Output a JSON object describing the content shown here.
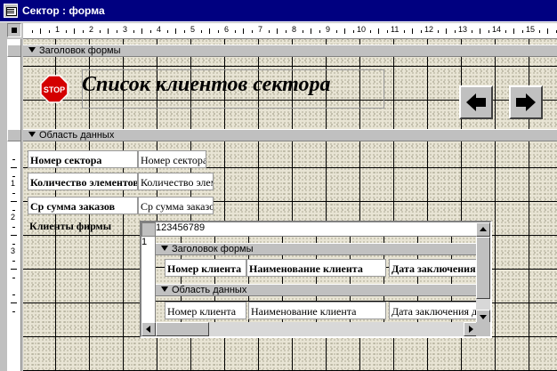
{
  "window": {
    "title": "Сектор : форма",
    "icon": "form-icon"
  },
  "ruler": {
    "numbers": [
      "1",
      "2",
      "3",
      "4",
      "5",
      "6",
      "7",
      "8",
      "9",
      "10",
      "11",
      "12",
      "13",
      "14",
      "15"
    ],
    "vertical_numbers": [
      "1",
      "2",
      "3"
    ]
  },
  "header_section": {
    "label": "Заголовок формы",
    "stop_icon_text": "STOP",
    "title": "Список клиентов сектора",
    "prev_button": "arrow-left-icon",
    "next_button": "arrow-right-icon"
  },
  "detail_section": {
    "label": "Область данных",
    "fields": [
      {
        "label": "Номер сектора",
        "value": "Номер сектора"
      },
      {
        "label": "Количество элементов",
        "value": "Количество элементов"
      },
      {
        "label": "Ср сумма заказов",
        "value": "Ср сумма заказов"
      },
      {
        "label": "Клиенты фирмы"
      }
    ]
  },
  "subform": {
    "ruler_numbers": [
      "1",
      "2",
      "3",
      "4",
      "5",
      "6",
      "7",
      "8",
      "9"
    ],
    "vertical_numbers": [
      "1"
    ],
    "header_label": "Заголовок формы",
    "detail_label": "Область данных",
    "columns": [
      "Номер клиента",
      "Наименование клиента",
      "Дата заключения"
    ],
    "field_values": [
      "Номер клиента",
      "Наименование клиента",
      "Дата заключения договора"
    ]
  }
}
